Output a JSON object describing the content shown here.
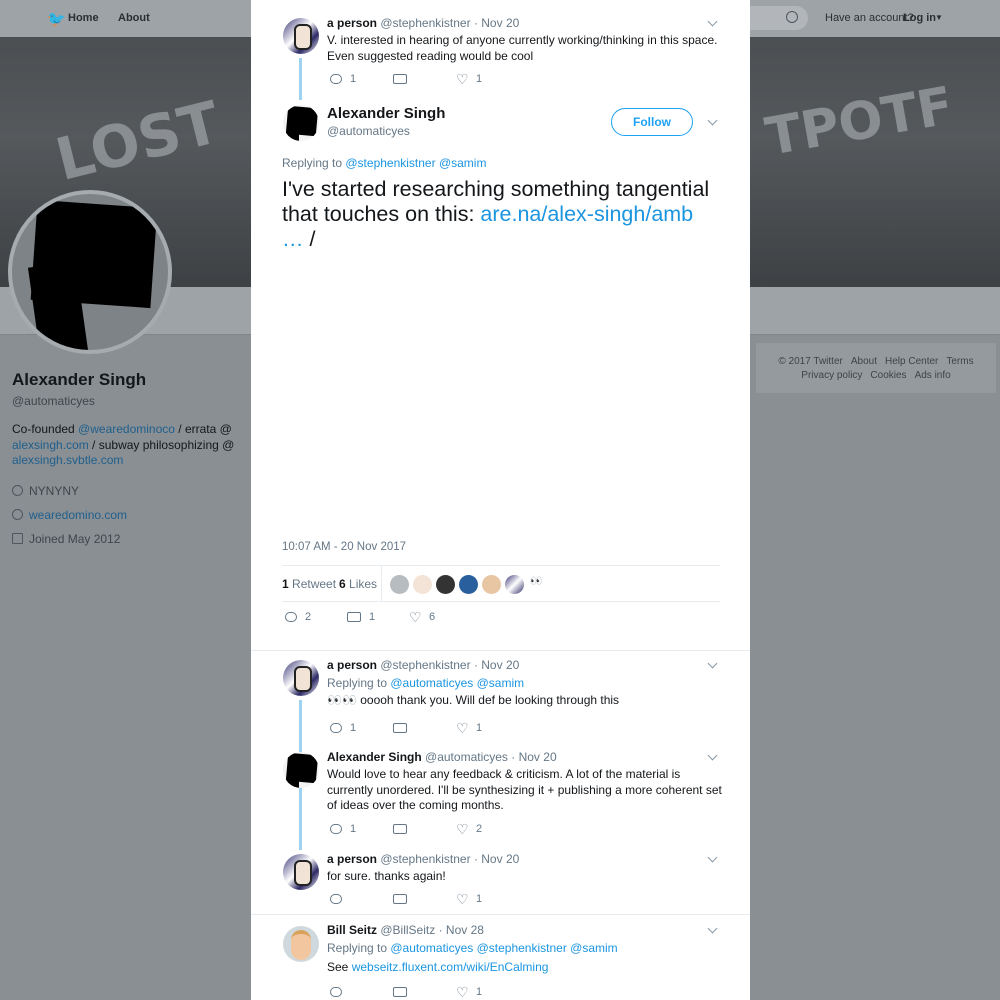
{
  "topbar": {
    "home_label": "Home",
    "about_label": "About",
    "account_prompt": "Have an account?",
    "login_label": "Log in"
  },
  "header_graffiti": {
    "left": "LOST",
    "right": "TPOTF"
  },
  "profile": {
    "name": "Alexander Singh",
    "handle": "@automaticyes",
    "bio_prefix": "Co-founded ",
    "bio_link1": "@wearedominoco",
    "bio_mid1": " / errata @ ",
    "bio_link2": "alexsingh.com",
    "bio_mid2": " / subway philosophizing @ ",
    "bio_link3": "alexsingh.svbtle.com",
    "location": "NYNYNY",
    "website": "wearedomino.com",
    "joined": "Joined May 2012"
  },
  "footer": {
    "copyright": "© 2017 Twitter",
    "about": "About",
    "help": "Help Center",
    "terms": "Terms",
    "privacy": "Privacy policy",
    "cookies": "Cookies",
    "ads": "Ads info"
  },
  "parent_tweet": {
    "name": "a person",
    "handle": "@stephenkistner",
    "date": "· Nov 20",
    "text": "V. interested in hearing of anyone currently working/thinking in this space. Even suggested reading would be cool",
    "replies": "1",
    "likes": "1"
  },
  "main_tweet": {
    "name": "Alexander Singh",
    "handle": "@automaticyes",
    "follow_label": "Follow",
    "replying_prefix": "Replying to ",
    "replying_to1": "@stephenkistner",
    "replying_to2": "@samim",
    "text_prefix": "I've started researching something tangential that touches on this: ",
    "text_link": "are.na/alex-singh/amb",
    "text_ellipsis": "…",
    "text_suffix": " /",
    "timestamp": "10:07 AM - 20 Nov 2017",
    "retweet_count": "1",
    "retweet_label": "Retweet",
    "like_count": "6",
    "like_label": "Likes",
    "replies": "2",
    "retweets": "1",
    "likes": "6"
  },
  "replies": [
    {
      "name": "a person",
      "handle": "@stephenkistner",
      "date": "· Nov 20",
      "replying_prefix": "Replying to ",
      "replying_to": "@automaticyes @samim",
      "text": "👀👀 ooooh thank you. Will def be looking through this",
      "replies": "1",
      "likes": "1"
    },
    {
      "name": "Alexander Singh",
      "handle": "@automaticyes",
      "date": "· Nov 20",
      "text": "Would love to hear any feedback & criticism. A lot of the material is currently unordered. I'll be synthesizing it + publishing a more coherent set of ideas over the coming months.",
      "replies": "1",
      "likes": "2"
    },
    {
      "name": "a person",
      "handle": "@stephenkistner",
      "date": "· Nov 20",
      "text": "for sure. thanks again!",
      "likes": "1"
    },
    {
      "name": "Bill Seitz",
      "handle": "@BillSeitz",
      "date": "· Nov 28",
      "replying_prefix": "Replying to ",
      "replying_to": "@automaticyes @stephenkistner @samim",
      "text_prefix": "See ",
      "text_link": "webseitz.fluxent.com/wiki/EnCalming",
      "likes": "1"
    }
  ],
  "colors": {
    "accent": "#1da1f2",
    "link": "#1b95e0",
    "thread_line": "#9fd2f0",
    "overlay_background": "#8a8f94"
  }
}
